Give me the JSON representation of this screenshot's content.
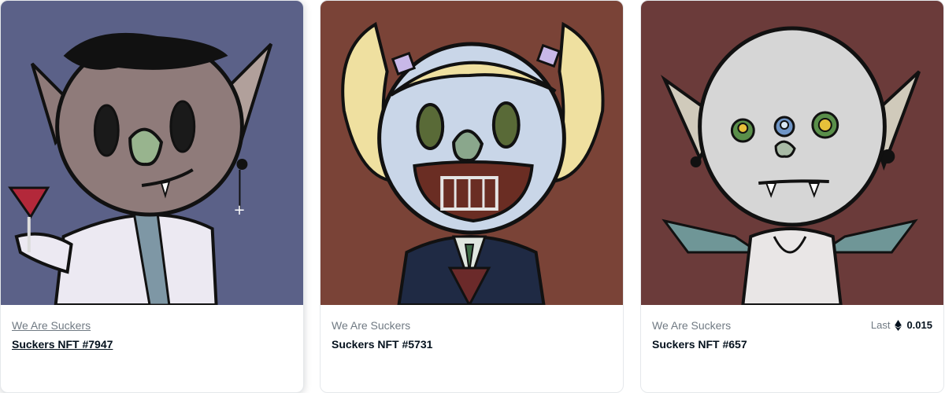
{
  "cards": [
    {
      "collection": "We Are Suckers",
      "name": "Suckers NFT #7947",
      "bg": "#5b6188"
    },
    {
      "collection": "We Are Suckers",
      "name": "Suckers NFT #5731",
      "bg": "#7a4337"
    },
    {
      "collection": "We Are Suckers",
      "name": "Suckers NFT #657",
      "bg": "#6b3b3a",
      "last_label": "Last",
      "currency_icon": "ethereum-icon",
      "last_price": "0.015"
    }
  ]
}
